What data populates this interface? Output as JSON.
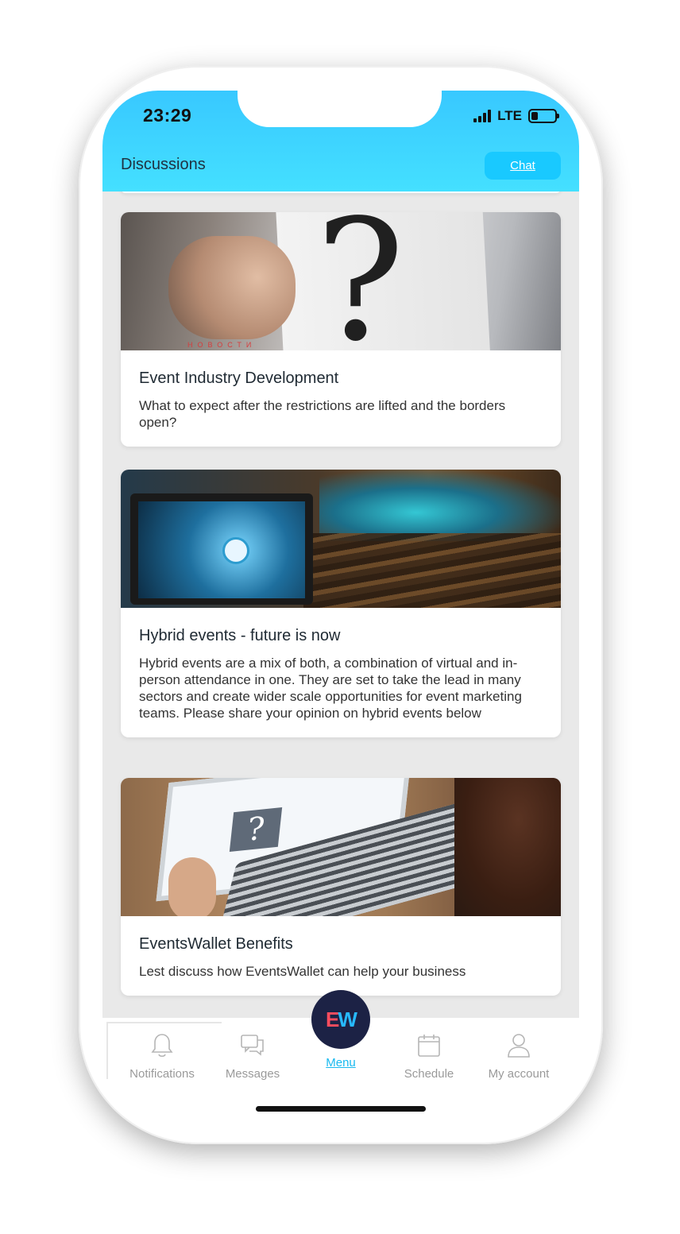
{
  "status_bar": {
    "time": "23:29",
    "network": "LTE",
    "icons": [
      "signal-icon",
      "battery-icon"
    ]
  },
  "header": {
    "title": "Discussions",
    "chat_button": "Chat",
    "gradient_colors": [
      "#38c8ff",
      "#44e0ff"
    ]
  },
  "cards": [
    {
      "image_caption": "НОВОСТИ",
      "title": "Event Industry Development",
      "text": "What to expect after the restrictions are lifted and the borders open?"
    },
    {
      "title": "Hybrid events - future is now",
      "text": "Hybrid events are a mix of both, a combination of virtual and in-person attendance in one. They are set to take the lead in many sectors and create wider scale opportunities for event marketing teams. Please share your opinion on hybrid events below"
    },
    {
      "title": "EventsWallet Benefits",
      "text": "Lest discuss how EventsWallet can help your business"
    }
  ],
  "tabbar": {
    "items": [
      {
        "label": "Notifications",
        "icon": "bell-icon"
      },
      {
        "label": "Messages",
        "icon": "chat-bubbles-icon"
      },
      {
        "label": "Menu",
        "icon": "ew-logo"
      },
      {
        "label": "Schedule",
        "icon": "calendar-icon"
      },
      {
        "label": "My account",
        "icon": "user-icon"
      }
    ],
    "logo_text": {
      "e": "E",
      "w": "W"
    },
    "accent_color": "#18b9ef"
  }
}
